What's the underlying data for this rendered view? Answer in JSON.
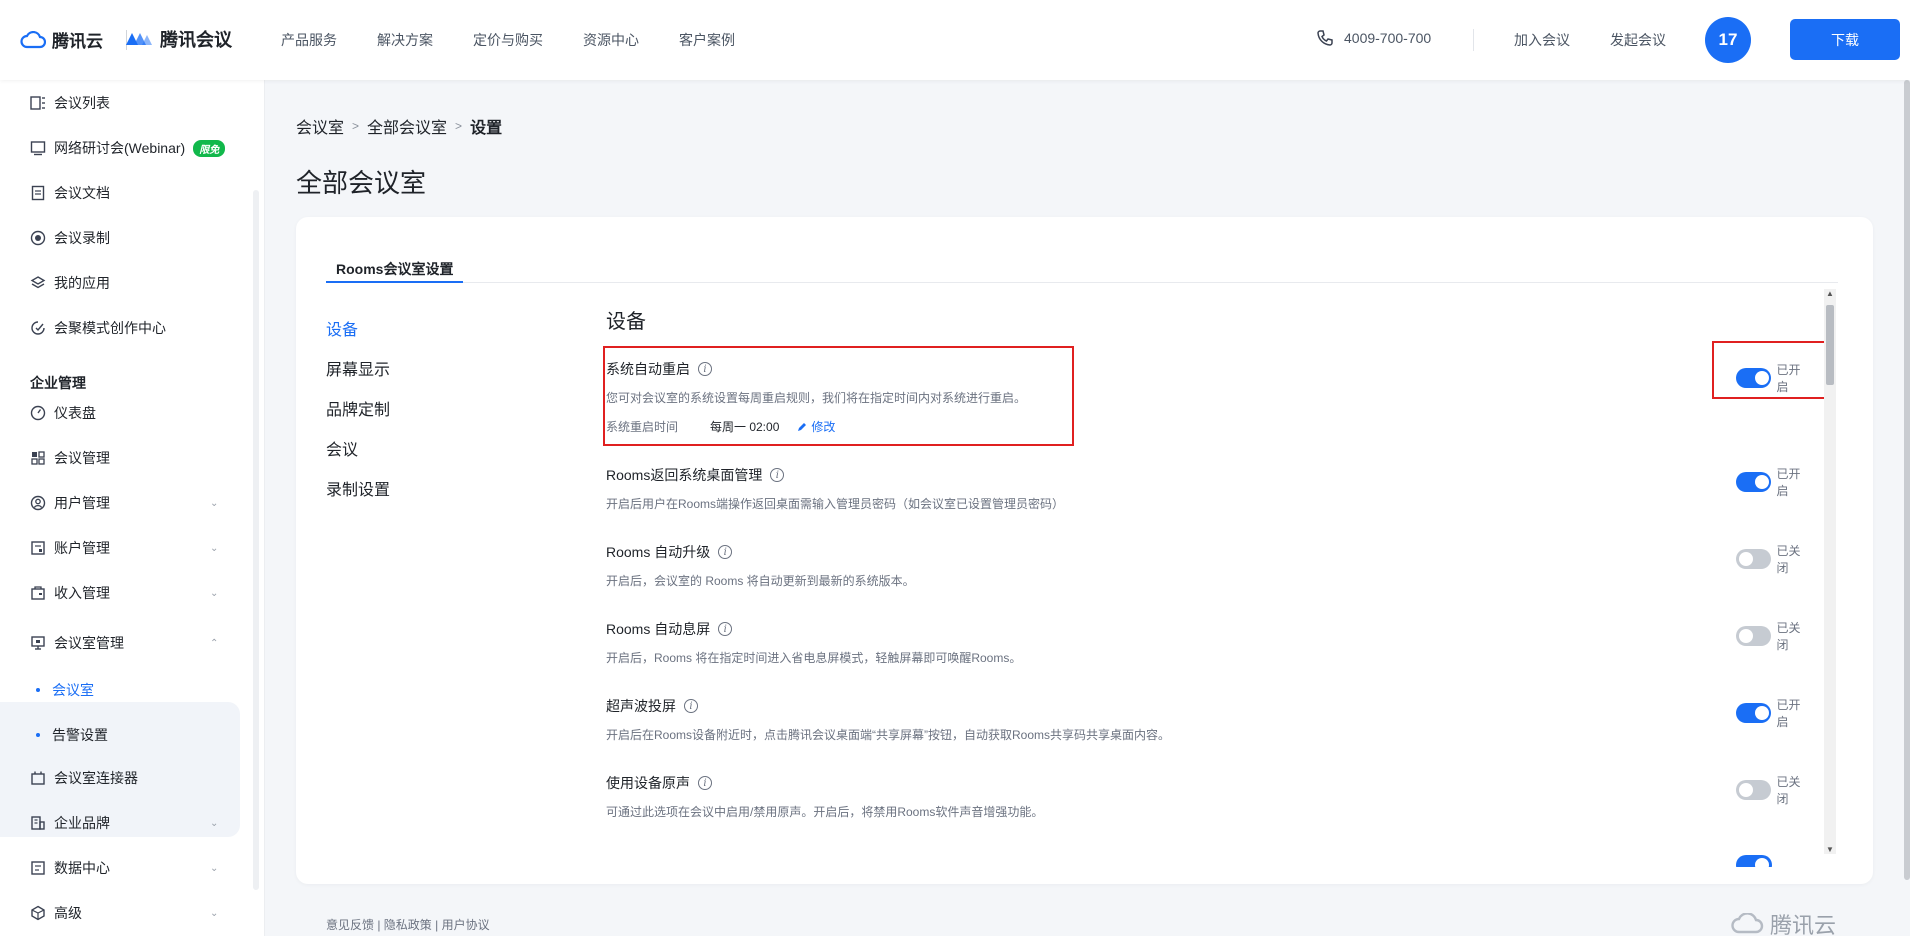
{
  "header": {
    "brand_cloud": "腾讯云",
    "brand_meeting": "腾讯会议",
    "nav": [
      "产品服务",
      "解决方案",
      "定价与购买",
      "资源中心",
      "客户案例"
    ],
    "phone": "4009-700-700",
    "join_label": "加入会议",
    "host_label": "发起会议",
    "avatar_text": "17",
    "download_label": "下载"
  },
  "sidebar": {
    "items": [
      {
        "label": "会议列表",
        "icon": "list-icon"
      },
      {
        "label": "网络研讨会(Webinar)",
        "icon": "monitor-icon",
        "badge": "限免"
      },
      {
        "label": "会议文档",
        "icon": "document-icon"
      },
      {
        "label": "会议录制",
        "icon": "record-icon"
      },
      {
        "label": "我的应用",
        "icon": "layers-icon"
      },
      {
        "label": "会聚模式创作中心",
        "icon": "studio-icon"
      }
    ],
    "group_title": "企业管理",
    "admin_items": [
      {
        "label": "仪表盘",
        "icon": "gauge-icon"
      },
      {
        "label": "会议管理",
        "icon": "grid-icon"
      },
      {
        "label": "用户管理",
        "icon": "user-icon"
      },
      {
        "label": "账户管理",
        "icon": "account-icon"
      },
      {
        "label": "收入管理",
        "icon": "wallet-icon"
      },
      {
        "label": "会议室管理",
        "icon": "room-icon"
      }
    ],
    "room_sub": [
      {
        "label": "会议室",
        "active": true
      },
      {
        "label": "告警设置",
        "active": false
      }
    ],
    "bottom_items": [
      {
        "label": "会议室连接器",
        "icon": "connector-icon"
      },
      {
        "label": "企业品牌",
        "icon": "brand-icon"
      },
      {
        "label": "数据中心",
        "icon": "data-icon"
      },
      {
        "label": "高级",
        "icon": "advanced-icon"
      }
    ]
  },
  "breadcrumb": [
    "会议室",
    "全部会议室",
    "设置"
  ],
  "page_title": "全部会议室",
  "tab_label": "Rooms会议室设置",
  "submenu": [
    "设备",
    "屏幕显示",
    "品牌定制",
    "会议",
    "录制设置"
  ],
  "section_title": "设备",
  "settings": [
    {
      "title": "系统自动重启",
      "desc": "您可对会议室的系统设置每周重启规则，我们将在指定时间内对系统进行重启。",
      "state": "已开启",
      "on": true,
      "restart_label": "系统重启时间",
      "restart_value": "每周一 02:00",
      "edit_label": "修改"
    },
    {
      "title": "Rooms返回系统桌面管理",
      "desc": "开启后用户在Rooms端操作返回桌面需输入管理员密码（如会议室已设置管理员密码）",
      "state": "已开启",
      "on": true
    },
    {
      "title": "Rooms 自动升级",
      "desc": "开启后，会议室的 Rooms 将自动更新到最新的系统版本。",
      "state": "已关闭",
      "on": false
    },
    {
      "title": "Rooms 自动息屏",
      "desc": "开启后，Rooms 将在指定时间进入省电息屏模式，轻触屏幕即可唤醒Rooms。",
      "state": "已关闭",
      "on": false
    },
    {
      "title": "超声波投屏",
      "desc": "开启后在Rooms设备附近时，点击腾讯会议桌面端“共享屏幕”按钮，自动获取Rooms共享码共享桌面内容。",
      "state": "已开启",
      "on": true
    },
    {
      "title": "使用设备原声",
      "desc": "可通过此选项在会议中启用/禁用原声。开启后，将禁用Rooms软件声音增强功能。",
      "state": "已关闭",
      "on": false
    }
  ],
  "footer": {
    "links": "意见反馈 | 隐私政策 | 用户协议",
    "logo_text": "腾讯云"
  },
  "colors": {
    "accent": "#1a6ef5",
    "highlight": "#e02020"
  }
}
